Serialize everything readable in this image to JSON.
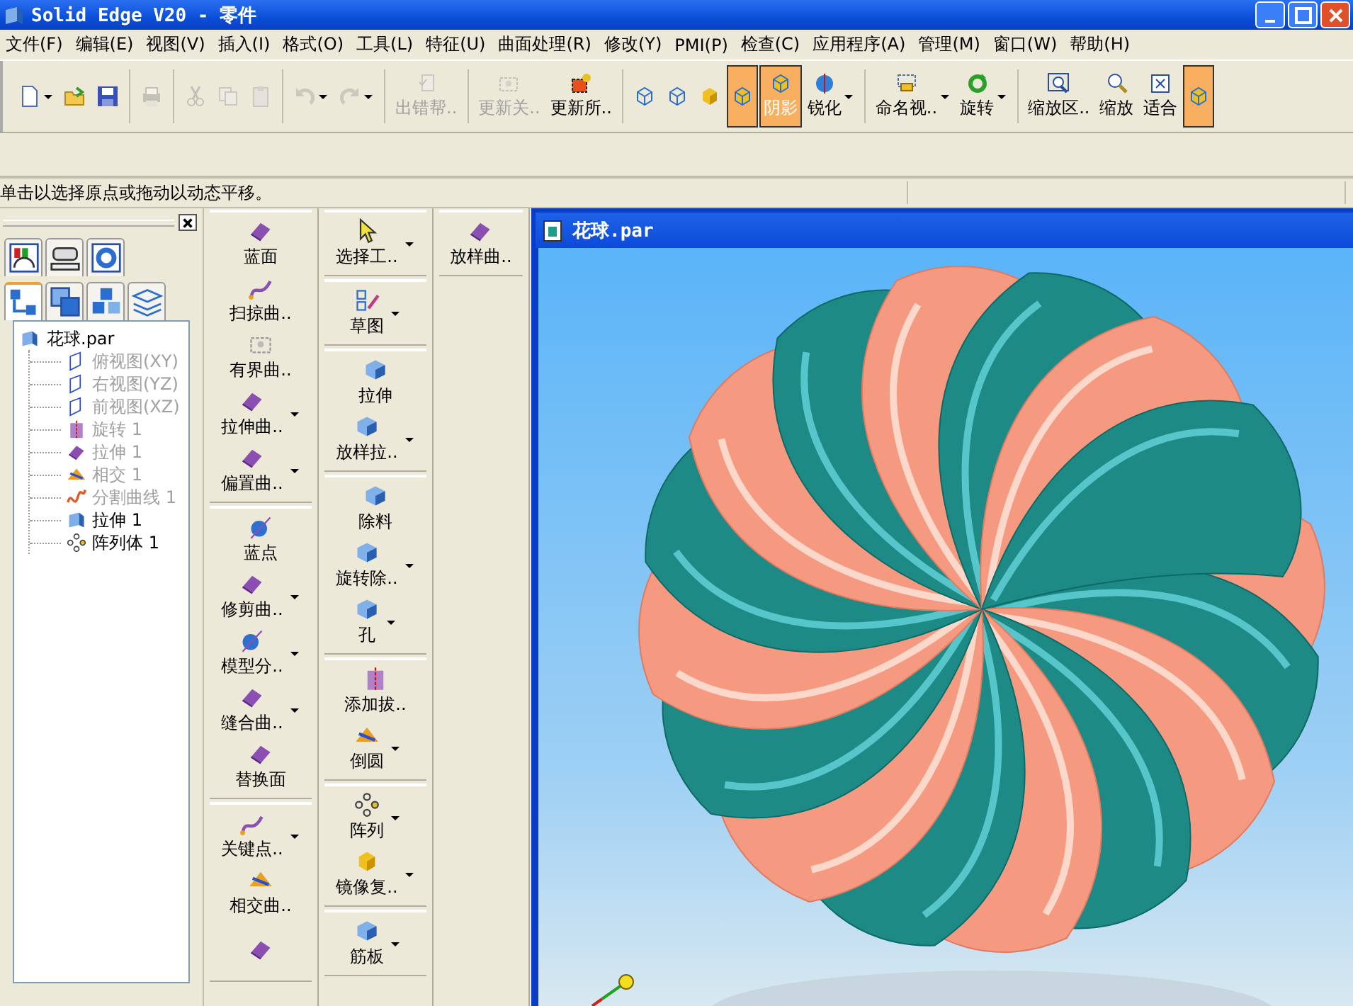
{
  "window": {
    "title": "Solid Edge V20 - 零件"
  },
  "menu": [
    "文件(F)",
    "编辑(E)",
    "视图(V)",
    "插入(I)",
    "格式(O)",
    "工具(L)",
    "特征(U)",
    "曲面处理(R)",
    "修改(Y)",
    "PMI(P)",
    "检查(C)",
    "应用程序(A)",
    "管理(M)",
    "窗口(W)",
    "帮助(H)"
  ],
  "toolbar": {
    "groups": [
      {
        "items": [
          {
            "dropdown": true,
            "disabled": false,
            "selected": false
          },
          {
            "dropdown": false,
            "disabled": false,
            "selected": false
          },
          {
            "dropdown": false,
            "disabled": false,
            "selected": false
          }
        ]
      },
      {
        "items": [
          {
            "dropdown": false,
            "disabled": true,
            "selected": false
          }
        ]
      },
      {
        "items": [
          {
            "dropdown": false,
            "disabled": true,
            "selected": false
          },
          {
            "dropdown": false,
            "disabled": true,
            "selected": false
          },
          {
            "dropdown": false,
            "disabled": true,
            "selected": false
          }
        ]
      },
      {
        "items": [
          {
            "dropdown": true,
            "disabled": true,
            "selected": false
          },
          {
            "dropdown": true,
            "disabled": true,
            "selected": false
          }
        ]
      },
      {
        "items": [
          {
            "label": "出错帮..",
            "dropdown": false,
            "disabled": true,
            "selected": false
          }
        ]
      },
      {
        "items": [
          {
            "label": "更新关..",
            "dropdown": false,
            "disabled": true,
            "selected": false
          },
          {
            "label": "更新所..",
            "dropdown": false,
            "disabled": false,
            "selected": false
          }
        ]
      },
      {
        "items": [
          {
            "dropdown": false,
            "disabled": false,
            "selected": false
          },
          {
            "dropdown": false,
            "disabled": false,
            "selected": false
          },
          {
            "dropdown": false,
            "disabled": false,
            "selected": false
          },
          {
            "dropdown": false,
            "disabled": false,
            "selected": true
          },
          {
            "label": "阴影",
            "dropdown": false,
            "disabled": false,
            "selected": true
          },
          {
            "label": "锐化",
            "dropdown": true,
            "disabled": false,
            "selected": false
          }
        ]
      },
      {
        "items": [
          {
            "label": "命名视..",
            "dropdown": true,
            "disabled": false,
            "selected": false
          },
          {
            "label": "旋转",
            "dropdown": true,
            "disabled": false,
            "selected": false
          }
        ]
      },
      {
        "items": [
          {
            "label": "缩放区..",
            "dropdown": false,
            "disabled": false,
            "selected": false
          },
          {
            "label": "缩放",
            "dropdown": false,
            "disabled": false,
            "selected": false
          },
          {
            "label": "适合",
            "dropdown": false,
            "disabled": false,
            "selected": false
          },
          {
            "dropdown": false,
            "disabled": false,
            "selected": true
          }
        ]
      }
    ]
  },
  "status_bar": {
    "prompt": "单击以选择原点或拖动以动态平移。"
  },
  "pathfinder": {
    "tab_rows": [
      [
        {
          "selected": false
        },
        {
          "selected": false
        },
        {
          "selected": false
        }
      ],
      [
        {
          "selected": true
        },
        {
          "selected": false
        },
        {
          "selected": false
        },
        {
          "selected": false
        }
      ]
    ],
    "tree": {
      "label": "花球.par",
      "children": [
        {
          "label": "俯视图(XY)",
          "disabled": true
        },
        {
          "label": "右视图(YZ)",
          "disabled": true
        },
        {
          "label": "前视图(XZ)",
          "disabled": true
        },
        {
          "label": "旋转 1",
          "disabled": true
        },
        {
          "label": "拉伸 1",
          "disabled": true
        },
        {
          "label": "相交 1",
          "disabled": true
        },
        {
          "label": "分割曲线 1",
          "disabled": true
        },
        {
          "label": "拉伸 1",
          "disabled": false
        },
        {
          "label": "阵列体 1",
          "disabled": false
        }
      ]
    }
  },
  "tool_columns": [
    {
      "groups": [
        {
          "items": [
            {
              "label": "蓝面",
              "dropdown": false
            },
            {
              "label": "扫掠曲..",
              "dropdown": false
            },
            {
              "label": "有界曲..",
              "dropdown": false
            },
            {
              "label": "拉伸曲..",
              "dropdown": true
            },
            {
              "label": "偏置曲..",
              "dropdown": true
            }
          ]
        },
        {
          "items": [
            {
              "label": "蓝点",
              "dropdown": false
            },
            {
              "label": "修剪曲..",
              "dropdown": true
            },
            {
              "label": "模型分..",
              "dropdown": true
            },
            {
              "label": "缝合曲..",
              "dropdown": true
            },
            {
              "label": "替换面",
              "dropdown": false
            }
          ]
        },
        {
          "items": [
            {
              "label": "关键点..",
              "dropdown": true
            },
            {
              "label": "相交曲..",
              "dropdown": false
            },
            {
              "dropdown": false
            }
          ]
        }
      ]
    },
    {
      "groups": [
        {
          "items": [
            {
              "label": "选择工..",
              "dropdown": true
            }
          ]
        },
        {
          "items": [
            {
              "label": "草图",
              "dropdown": true
            }
          ]
        },
        {
          "items": [
            {
              "label": "拉伸",
              "dropdown": false
            },
            {
              "label": "放样拉..",
              "dropdown": true
            }
          ]
        },
        {
          "items": [
            {
              "label": "除料",
              "dropdown": false
            },
            {
              "label": "旋转除..",
              "dropdown": true
            },
            {
              "label": "孔",
              "dropdown": true
            }
          ]
        },
        {
          "items": [
            {
              "label": "添加拔..",
              "dropdown": false
            },
            {
              "label": "倒圆",
              "dropdown": true
            }
          ]
        },
        {
          "items": [
            {
              "label": "阵列",
              "dropdown": true
            },
            {
              "label": "镜像复..",
              "dropdown": true
            }
          ]
        },
        {
          "items": [
            {
              "label": "筋板",
              "dropdown": true
            }
          ]
        }
      ]
    },
    {
      "groups": [
        {
          "items": [
            {
              "label": "放样曲..",
              "dropdown": false
            }
          ]
        }
      ]
    }
  ],
  "document": {
    "title": "花球.par"
  }
}
